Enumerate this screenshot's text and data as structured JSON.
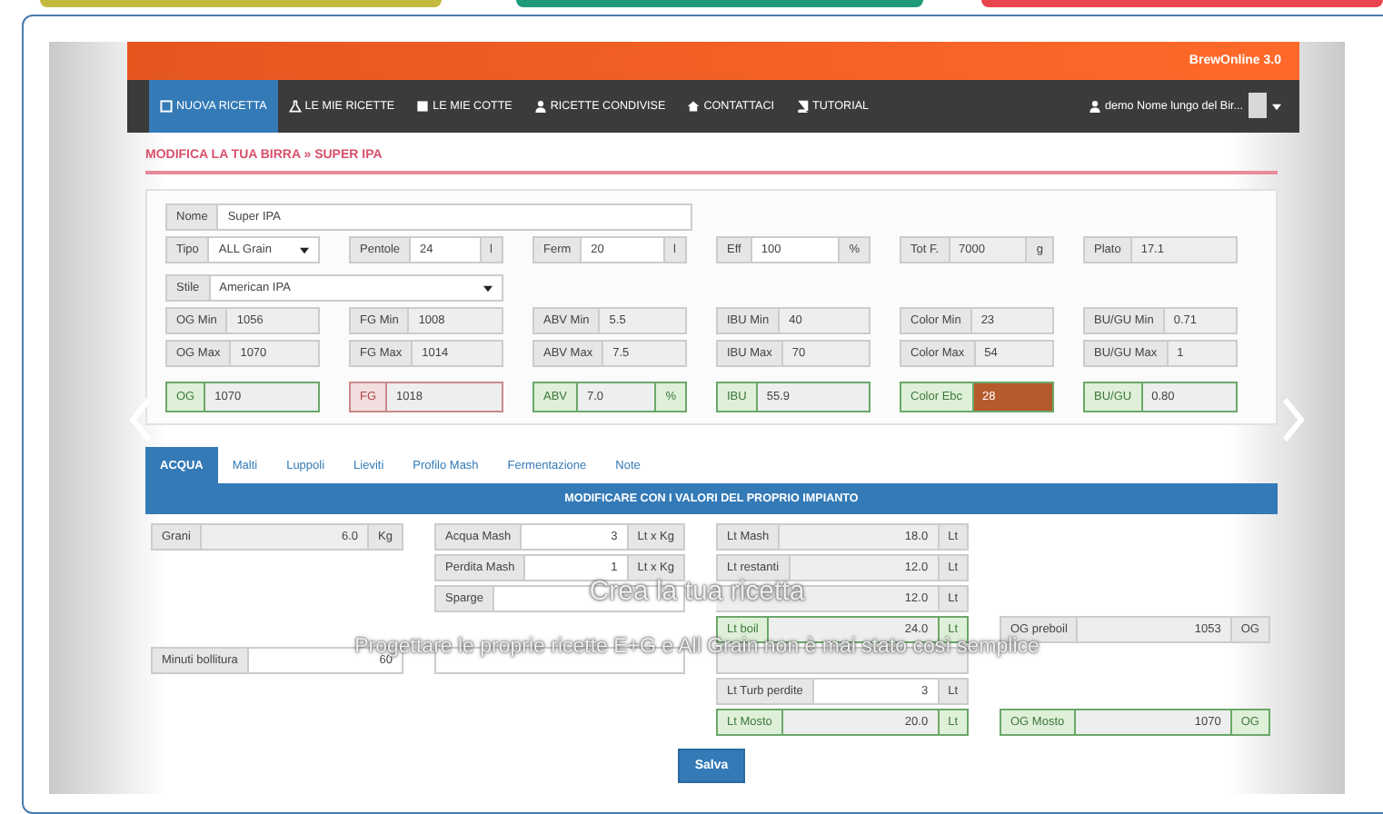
{
  "site": {
    "brand": "BrewOnline 3.0"
  },
  "nav": {
    "items": [
      {
        "label": "NUOVA RICETTA",
        "selected": true
      },
      {
        "label": "LE MIE RICETTE",
        "selected": false
      },
      {
        "label": "LE MIE COTTE",
        "selected": false
      },
      {
        "label": "RICETTE CONDIVISE",
        "selected": false
      },
      {
        "label": "CONTATTACI",
        "selected": false
      },
      {
        "label": "TUTORIAL",
        "selected": false
      }
    ],
    "user": "demo Nome lungo del Bir..."
  },
  "page_title": "MODIFICA LA TUA BIRRA » SUPER IPA",
  "recipe_form": {
    "rows": [
      [
        {
          "label": "Nome",
          "value": "Super IPA",
          "kind": "input"
        }
      ],
      [
        {
          "label": "Tipo",
          "value": "ALL Grain",
          "kind": "select"
        },
        {
          "label": "Pentole",
          "value": "24",
          "unit": "l",
          "kind": "input"
        },
        {
          "label": "Ferm",
          "value": "20",
          "unit": "l",
          "kind": "input"
        },
        {
          "label": "Eff",
          "value": "100",
          "unit": "%",
          "kind": "input"
        },
        {
          "label": "Tot F.",
          "value": "7000",
          "unit": "g",
          "kind": "readonly"
        },
        {
          "label": "Plato",
          "value": "17.1",
          "kind": "readonly"
        }
      ],
      [
        {
          "label": "Stile",
          "value": "American IPA",
          "kind": "select"
        }
      ],
      [
        {
          "label": "OG Min",
          "value": "1056",
          "kind": "readonly"
        },
        {
          "label": "FG Min",
          "value": "1008",
          "kind": "readonly"
        },
        {
          "label": "ABV Min",
          "value": "5.5",
          "kind": "readonly"
        },
        {
          "label": "IBU Min",
          "value": "40",
          "kind": "readonly"
        },
        {
          "label": "Color Min",
          "value": "23",
          "kind": "readonly"
        },
        {
          "label": "BU/GU Min",
          "value": "0.71",
          "kind": "readonly"
        }
      ],
      [
        {
          "label": "OG Max",
          "value": "1070",
          "kind": "readonly"
        },
        {
          "label": "FG Max",
          "value": "1014",
          "kind": "readonly"
        },
        {
          "label": "ABV Max",
          "value": "7.5",
          "kind": "readonly"
        },
        {
          "label": "IBU Max",
          "value": "70",
          "kind": "readonly"
        },
        {
          "label": "Color Max",
          "value": "54",
          "kind": "readonly"
        },
        {
          "label": "BU/GU Max",
          "value": "1",
          "kind": "readonly"
        }
      ],
      [
        {
          "label": "OG",
          "value": "1070",
          "kind": "readonly",
          "valid": true
        },
        {
          "label": "FG",
          "value": "1018",
          "kind": "readonly",
          "valid": false
        },
        {
          "label": "ABV",
          "value": "7.0",
          "unit": "%",
          "kind": "readonly",
          "valid": true
        },
        {
          "label": "IBU",
          "value": "55.9",
          "kind": "readonly",
          "valid": true
        },
        {
          "label": "Color Ebc",
          "value": "28",
          "kind": "readonly",
          "valid": true,
          "color": "#b55a2c"
        },
        {
          "label": "BU/GU",
          "value": "0.80",
          "kind": "readonly",
          "valid": true
        }
      ]
    ]
  },
  "tabs": [
    {
      "label": "ACQUA",
      "selected": true
    },
    {
      "label": "Malti",
      "selected": false
    },
    {
      "label": "Luppoli",
      "selected": false
    },
    {
      "label": "Lieviti",
      "selected": false
    },
    {
      "label": "Profilo Mash",
      "selected": false
    },
    {
      "label": "Fermentazione",
      "selected": false
    },
    {
      "label": "Note",
      "selected": false
    }
  ],
  "banner": "MODIFICARE CON I VALORI DEL PROPRIO IMPIANTO",
  "water": {
    "rows": [
      [
        {
          "label": "Grani",
          "value": "6.0",
          "unit": "Kg",
          "kind": "readonly"
        },
        {
          "label": "Acqua Mash",
          "value": "3",
          "unit": "Lt x Kg",
          "kind": "input"
        },
        {
          "label": "Lt Mash",
          "value": "18.0",
          "unit": "Lt",
          "kind": "readonly"
        },
        null
      ],
      [
        null,
        {
          "label": "Perdita Mash",
          "value": "1",
          "unit": "Lt x Kg",
          "kind": "input"
        },
        {
          "label": "Lt restanti",
          "value": "12.0",
          "unit": "Lt",
          "kind": "readonly"
        },
        null
      ],
      [
        null,
        {
          "label": "Sparge",
          "kind": "input"
        },
        {
          "value": "12.0",
          "unit": "Lt",
          "kind": "readonly"
        },
        null
      ],
      [
        null,
        null,
        {
          "label": "Lt boil",
          "value": "24.0",
          "unit": "Lt",
          "kind": "readonly",
          "valid": true
        },
        {
          "label": "OG preboil",
          "value": "1053",
          "unit": "OG",
          "kind": "readonly"
        }
      ],
      [
        {
          "label": "Minuti bollitura",
          "value": "60",
          "kind": "input"
        },
        {
          "kind": "input"
        },
        {
          "kind": "readonly"
        },
        null
      ],
      [
        null,
        null,
        {
          "label": "Lt Turb perdite",
          "value": "3",
          "unit": "Lt",
          "kind": "input"
        },
        null
      ],
      [
        null,
        null,
        {
          "label": "Lt Mosto",
          "value": "20.0",
          "unit": "Lt",
          "kind": "readonly",
          "valid": true
        },
        {
          "label": "OG Mosto",
          "value": "1070",
          "unit": "OG",
          "kind": "readonly",
          "valid": true
        }
      ]
    ]
  },
  "save_button": "Salva",
  "caption": {
    "title": "Crea la tua ricetta",
    "text": "Progettare le proprie ricette E+G e All Grain non è mai stato così semplice"
  }
}
